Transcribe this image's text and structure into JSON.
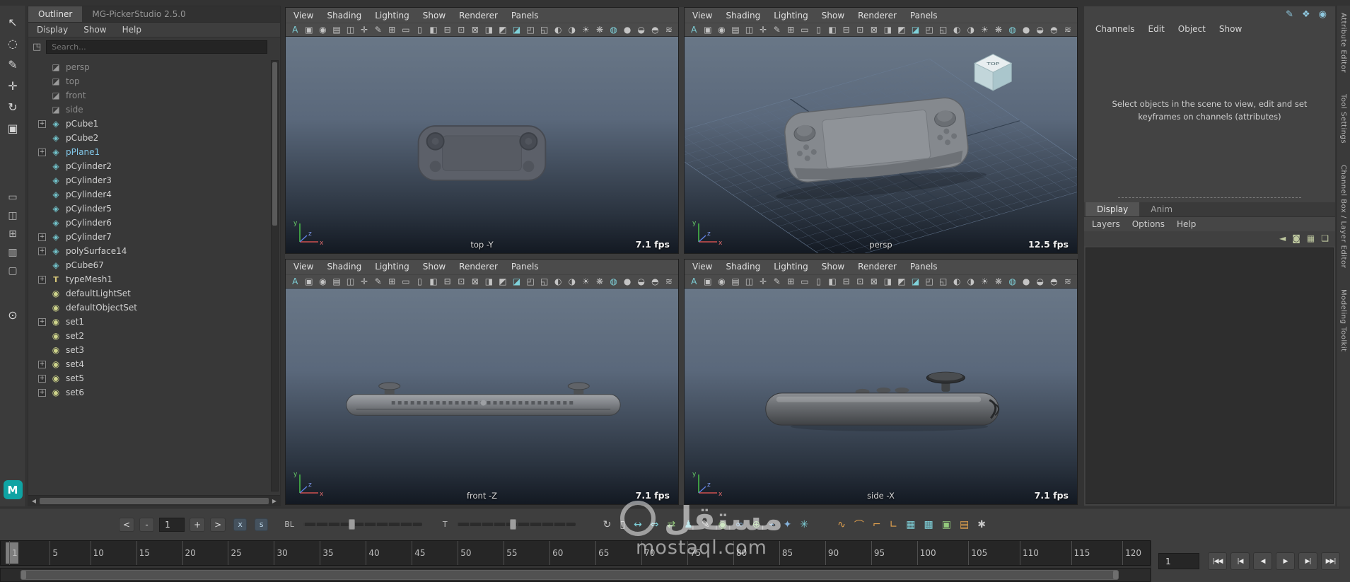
{
  "window": {
    "titlebar_icons": [
      {
        "name": "pin-icon",
        "glyph": "✎"
      },
      {
        "name": "whats-new-icon",
        "glyph": "❖"
      },
      {
        "name": "capture-icon",
        "glyph": "◉"
      }
    ]
  },
  "toolbox": {
    "tools": [
      {
        "name": "select-tool-icon",
        "glyph": "↖"
      },
      {
        "name": "lasso-select-tool-icon",
        "glyph": "◌"
      },
      {
        "name": "paint-select-tool-icon",
        "glyph": "✎"
      },
      {
        "name": "move-tool-icon",
        "glyph": "✛"
      },
      {
        "name": "rotate-tool-icon",
        "glyph": "↻"
      },
      {
        "name": "scale-tool-icon",
        "glyph": "▣"
      }
    ],
    "layouts": [
      {
        "name": "single-pane-layout-icon",
        "glyph": "▭"
      },
      {
        "name": "two-pane-layout-icon",
        "glyph": "◫"
      },
      {
        "name": "four-pane-layout-icon",
        "glyph": "⊞"
      },
      {
        "name": "outliner-persp-layout-icon",
        "glyph": "▥"
      },
      {
        "name": "custom-pane-layout-icon",
        "glyph": "▢"
      }
    ],
    "zoom_tool_glyph": "⊙",
    "maya_logo": "M"
  },
  "outliner": {
    "tabs": [
      {
        "label": "Outliner",
        "active": true
      },
      {
        "label": "MG-PickerStudio 2.5.0",
        "active": false
      }
    ],
    "menus": [
      "Display",
      "Show",
      "Help"
    ],
    "search": {
      "placeholder": "Search...",
      "icon_glyph": "◳"
    },
    "scroll": {
      "left": "◀",
      "right": "▶"
    },
    "items": [
      {
        "label": "persp",
        "icon": "camera",
        "muted": true
      },
      {
        "label": "top",
        "icon": "camera",
        "muted": true
      },
      {
        "label": "front",
        "icon": "camera",
        "muted": true
      },
      {
        "label": "side",
        "icon": "camera",
        "muted": true
      },
      {
        "label": "pCube1",
        "icon": "mesh",
        "expand": true
      },
      {
        "label": "pCube2",
        "icon": "mesh"
      },
      {
        "label": "pPlane1",
        "icon": "mesh",
        "expand": true,
        "highlight": true
      },
      {
        "label": "pCylinder2",
        "icon": "mesh"
      },
      {
        "label": "pCylinder3",
        "icon": "mesh"
      },
      {
        "label": "pCylinder4",
        "icon": "mesh"
      },
      {
        "label": "pCylinder5",
        "icon": "mesh"
      },
      {
        "label": "pCylinder6",
        "icon": "mesh"
      },
      {
        "label": "pCylinder7",
        "icon": "mesh",
        "expand": true
      },
      {
        "label": "polySurface14",
        "icon": "mesh",
        "expand": true
      },
      {
        "label": "pCube67",
        "icon": "mesh"
      },
      {
        "label": "typeMesh1",
        "icon": "type",
        "expand": true
      },
      {
        "label": "defaultLightSet",
        "icon": "set"
      },
      {
        "label": "defaultObjectSet",
        "icon": "set"
      },
      {
        "label": "set1",
        "icon": "set",
        "expand": true
      },
      {
        "label": "set2",
        "icon": "set"
      },
      {
        "label": "set3",
        "icon": "set"
      },
      {
        "label": "set4",
        "icon": "set",
        "expand": true
      },
      {
        "label": "set5",
        "icon": "set",
        "expand": true
      },
      {
        "label": "set6",
        "icon": "set",
        "expand": true
      }
    ]
  },
  "viewport_menu": {
    "items": [
      "View",
      "Shading",
      "Lighting",
      "Show",
      "Renderer",
      "Panels"
    ]
  },
  "viewport_toolbar": {
    "icons": [
      {
        "name": "camera-select-icon",
        "glyph": "A",
        "tone": "teal"
      },
      {
        "name": "lock-camera-icon",
        "glyph": "▣"
      },
      {
        "name": "camera-attributes-icon",
        "glyph": "◉"
      },
      {
        "name": "bookmarks-icon",
        "glyph": "▤"
      },
      {
        "name": "image-plane-icon",
        "glyph": "◫"
      },
      {
        "name": "pan-zoom-icon",
        "glyph": "✛"
      },
      {
        "name": "grease-pencil-icon",
        "glyph": "✎"
      },
      {
        "name": "grid-toggle-icon",
        "glyph": "⊞"
      },
      {
        "name": "film-gate-icon",
        "glyph": "▭"
      },
      {
        "name": "resolution-gate-icon",
        "glyph": "▯"
      },
      {
        "name": "gate-mask-icon",
        "glyph": "◧"
      },
      {
        "name": "field-chart-icon",
        "glyph": "⊟"
      },
      {
        "name": "safe-action-icon",
        "glyph": "⊡"
      },
      {
        "name": "safe-title-icon",
        "glyph": "⊠"
      },
      {
        "name": "frame-all-icon",
        "glyph": "◨"
      },
      {
        "name": "frame-selected-icon",
        "glyph": "◩"
      },
      {
        "name": "isolate-select-icon",
        "glyph": "◪",
        "tone": "teal"
      },
      {
        "name": "xray-icon",
        "glyph": "◰"
      },
      {
        "name": "xray-joints-icon",
        "glyph": "◱"
      },
      {
        "name": "exposure-icon",
        "glyph": "◐"
      },
      {
        "name": "gamma-icon",
        "glyph": "◑"
      },
      {
        "name": "lighting-icon",
        "glyph": "☀"
      },
      {
        "name": "shadows-icon",
        "glyph": "❋"
      },
      {
        "name": "ao-icon",
        "glyph": "◍",
        "tone": "teal"
      },
      {
        "name": "anti-alias-icon",
        "glyph": "●"
      },
      {
        "name": "wireframe-on-shaded-icon",
        "glyph": "◒"
      },
      {
        "name": "textured-icon",
        "glyph": "◓"
      },
      {
        "name": "fog-icon",
        "glyph": "≋"
      }
    ]
  },
  "viewports": {
    "top": {
      "label": "top -Y",
      "fps": "7.1 fps"
    },
    "persp": {
      "label": "persp",
      "fps": "12.5 fps",
      "viewcube_label": "TOP"
    },
    "front": {
      "label": "front -Z",
      "fps": "7.1 fps"
    },
    "side": {
      "label": "side -X",
      "fps": "7.1 fps"
    }
  },
  "axis_labels": {
    "up": "y",
    "right": "x",
    "depth": "z"
  },
  "channel_box": {
    "menus": [
      "Channels",
      "Edit",
      "Object",
      "Show"
    ],
    "message": "Select objects in the scene to view, edit and set keyframes on channels (attributes)",
    "tabs": [
      {
        "label": "Display",
        "active": true
      },
      {
        "label": "Anim",
        "active": false
      }
    ],
    "subtabs": [
      "Layers",
      "Options",
      "Help"
    ],
    "layer_icons": [
      {
        "name": "layer-prev-icon",
        "glyph": "◄"
      },
      {
        "name": "layer-current-icon",
        "glyph": "◙"
      },
      {
        "name": "new-empty-layer-icon",
        "glyph": "▦"
      },
      {
        "name": "new-layer-from-selected-icon",
        "glyph": "❏"
      }
    ]
  },
  "side_tabs": [
    "Attribute Editor",
    "Tool Settings",
    "Channel Box / Layer Editor",
    "Modeling Toolkit"
  ],
  "playback": {
    "step_back_label": "<",
    "minus_label": "-",
    "frame_value": "1",
    "plus_label": "+",
    "step_forward_label": ">",
    "toggle_x": "x",
    "toggle_s": "s",
    "bl_label": "BL",
    "t_label": "T",
    "icons": [
      {
        "name": "loop-playback-icon",
        "glyph": "↻"
      },
      {
        "name": "clip-range-icon",
        "glyph": "▯"
      },
      {
        "name": "frame-all-keys-icon",
        "glyph": "↔",
        "tone": "teal"
      },
      {
        "name": "frame-playback-range-icon",
        "glyph": "⇔",
        "tone": "teal"
      },
      {
        "name": "swap-range-icon",
        "glyph": "⇄",
        "tone": "green"
      },
      {
        "name": "character-set-icon",
        "glyph": "♟",
        "tone": "teal"
      },
      {
        "name": "grease-pencil-anim-icon",
        "glyph": "✎"
      },
      {
        "name": "camera-keys-icon",
        "glyph": "◉",
        "tone": "green"
      },
      {
        "name": "link-icon",
        "glyph": "∞",
        "tone": "blue"
      },
      {
        "name": "constraint-icon",
        "glyph": "⊕",
        "tone": "green"
      },
      {
        "name": "set-key-icon",
        "glyph": "⌁",
        "tone": "blue"
      },
      {
        "name": "snap-keys-icon",
        "glyph": "✦",
        "tone": "blue"
      },
      {
        "name": "mute-channel-icon",
        "glyph": "✳",
        "tone": "teal"
      }
    ],
    "right_icons": [
      {
        "name": "anim-curve-spline-icon",
        "glyph": "∿",
        "tone": "orange"
      },
      {
        "name": "anim-curve-linear-icon",
        "glyph": "⌒",
        "tone": "orange"
      },
      {
        "name": "anim-curve-step-icon",
        "glyph": "⌐",
        "tone": "orange"
      },
      {
        "name": "anim-curve-auto-icon",
        "glyph": "∟",
        "tone": "orange"
      },
      {
        "name": "grid-layout-icon",
        "glyph": "▦",
        "tone": "teal"
      },
      {
        "name": "checker-icon",
        "glyph": "▩",
        "tone": "teal"
      },
      {
        "name": "render-icon",
        "glyph": "▣",
        "tone": "green"
      },
      {
        "name": "ipr-render-icon",
        "glyph": "▤",
        "tone": "orange"
      },
      {
        "name": "settings-gear-icon",
        "glyph": "✱"
      }
    ]
  },
  "timeline": {
    "frames": [
      "1",
      "5",
      "10",
      "15",
      "20",
      "25",
      "30",
      "35",
      "40",
      "45",
      "50",
      "55",
      "60",
      "65",
      "70",
      "75",
      "80",
      "85",
      "90",
      "95",
      "100",
      "105",
      "110",
      "115",
      "120"
    ],
    "current_frame": "1"
  },
  "transport": {
    "frame_field": "1",
    "buttons": [
      {
        "name": "go-to-start-button",
        "glyph": "|◀◀"
      },
      {
        "name": "step-back-button",
        "glyph": "|◀"
      },
      {
        "name": "play-backwards-button",
        "glyph": "◀"
      },
      {
        "name": "play-forwards-button",
        "glyph": "▶"
      },
      {
        "name": "step-forward-button",
        "glyph": "▶|"
      },
      {
        "name": "go-to-end-button",
        "glyph": "▶▶|"
      }
    ]
  },
  "watermark": {
    "arabic": "مستقل",
    "latin": "mostaql.com"
  }
}
